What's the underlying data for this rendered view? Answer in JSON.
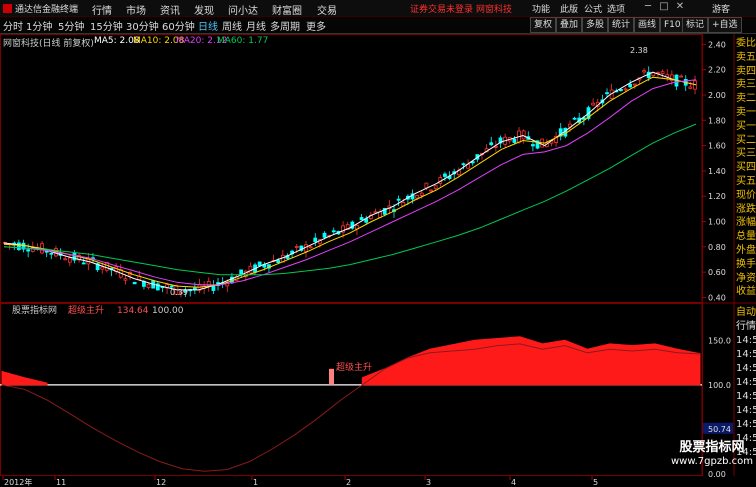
{
  "app": {
    "title": "通达信金融终端",
    "menu": [
      "行情",
      "市场",
      "资讯",
      "发现",
      "问小达",
      "财富圈",
      "交易"
    ],
    "notice": "证券交易未登录",
    "notice2": "网窗科技",
    "right_menu": [
      "功能",
      "此版",
      "公式",
      "选项"
    ],
    "guest": "游客"
  },
  "periods": [
    "分时",
    "1分钟",
    "5分钟",
    "15分钟",
    "30分钟",
    "60分钟",
    "日线",
    "周线",
    "月线",
    "多周期",
    "更多"
  ],
  "active_period": "日线",
  "toolbar": [
    "复权",
    "叠加",
    "多股",
    "统计",
    "画线",
    "F10",
    "标记",
    "+自选"
  ],
  "stock": {
    "name": "网窗科技(日线 前复权)",
    "ma5": "MA5: 2.08",
    "ma10": "MA10: 2.08",
    "ma20": "MA20: 2.12",
    "ma60": "MA60: 1.77",
    "high_label": "2.38",
    "low_label": "0.39"
  },
  "colors": {
    "ma5": "#ffffff",
    "ma10": "#ffd700",
    "ma20": "#e040fb",
    "ma60": "#00c853",
    "up": "#ff3232",
    "down": "#00ffff"
  },
  "price_axis": [
    "2.40",
    "2.20",
    "2.00",
    "1.80",
    "1.60",
    "1.40",
    "1.20",
    "1.00",
    "0.80",
    "0.60",
    "0.40"
  ],
  "right_panel_top": [
    "委比",
    "卖五",
    "卖四",
    "卖三",
    "卖二",
    "卖一",
    "买一",
    "买二",
    "买三",
    "买四",
    "买五",
    "现价",
    "涨跌",
    "涨幅",
    "总量",
    "外盘",
    "换手",
    "净资",
    "收益"
  ],
  "indicator": {
    "name": "股票指标网",
    "series_name": "超级主升",
    "value": "134.64",
    "value2": "100.00",
    "signal_label": "超级主升",
    "axis": [
      "150.0",
      "100.0",
      "50.74",
      "0.00"
    ]
  },
  "right_panel_bottom": [
    "自动",
    "行情",
    "14:56",
    "14:56",
    "14:56",
    "14:56",
    "14:56",
    "14:56",
    "14:56",
    "14:56",
    "14:56"
  ],
  "x_axis": [
    "2012年",
    "11",
    "12",
    "1",
    "2",
    "3",
    "4",
    "5"
  ],
  "watermark": {
    "cn": "股票指标网",
    "url": "www.7gpzb.com"
  },
  "chart_data": {
    "type": "line",
    "title": "网窗科技(日线 前复权)",
    "ylim": [
      0.38,
      2.45
    ],
    "series": [
      {
        "name": "MA5",
        "values": [
          0.83,
          0.81,
          0.77,
          0.72,
          0.68,
          0.62,
          0.55,
          0.5,
          0.46,
          0.46,
          0.51,
          0.58,
          0.66,
          0.72,
          0.8,
          0.88,
          0.95,
          1.05,
          1.12,
          1.22,
          1.3,
          1.4,
          1.52,
          1.63,
          1.68,
          1.6,
          1.72,
          1.85,
          2.0,
          2.1,
          2.18,
          2.12,
          2.08
        ]
      },
      {
        "name": "MA10",
        "values": [
          0.82,
          0.81,
          0.78,
          0.74,
          0.7,
          0.64,
          0.58,
          0.53,
          0.49,
          0.48,
          0.5,
          0.56,
          0.62,
          0.69,
          0.76,
          0.84,
          0.91,
          1.0,
          1.08,
          1.17,
          1.25,
          1.35,
          1.46,
          1.57,
          1.64,
          1.62,
          1.7,
          1.82,
          1.95,
          2.05,
          2.14,
          2.12,
          2.08
        ]
      },
      {
        "name": "MA20",
        "values": [
          0.8,
          0.79,
          0.77,
          0.74,
          0.71,
          0.66,
          0.61,
          0.56,
          0.52,
          0.5,
          0.5,
          0.53,
          0.58,
          0.64,
          0.7,
          0.77,
          0.84,
          0.92,
          1.0,
          1.08,
          1.16,
          1.25,
          1.35,
          1.45,
          1.53,
          1.55,
          1.6,
          1.7,
          1.82,
          1.95,
          2.05,
          2.1,
          2.12
        ]
      },
      {
        "name": "MA60",
        "values": [
          0.8,
          0.79,
          0.78,
          0.76,
          0.74,
          0.71,
          0.68,
          0.65,
          0.62,
          0.6,
          0.58,
          0.58,
          0.58,
          0.59,
          0.61,
          0.63,
          0.66,
          0.7,
          0.74,
          0.79,
          0.84,
          0.89,
          0.95,
          1.02,
          1.09,
          1.16,
          1.24,
          1.33,
          1.42,
          1.52,
          1.62,
          1.7,
          1.77
        ]
      }
    ],
    "indicator_series": {
      "name": "超级主升",
      "ylim": [
        0,
        175
      ],
      "line_values": [
        100,
        95,
        83,
        68,
        52,
        38,
        25,
        14,
        6,
        3,
        5,
        14,
        28,
        44,
        62,
        82,
        100,
        118,
        130,
        136,
        138,
        140,
        144,
        146,
        140,
        144,
        136,
        140,
        138,
        140,
        136,
        134.64
      ],
      "area_values": [
        115,
        108,
        102,
        0,
        0,
        0,
        0,
        0,
        0,
        0,
        0,
        0,
        0,
        0,
        0,
        0,
        108,
        118,
        130,
        140,
        145,
        150,
        152,
        154,
        146,
        150,
        140,
        146,
        144,
        146,
        140,
        135
      ],
      "baseline": 100
    },
    "ticks_x": [
      "2012年",
      "11",
      "12",
      "1",
      "2",
      "3",
      "4",
      "5"
    ],
    "ticks_y": [
      "2.40",
      "2.20",
      "2.00",
      "1.80",
      "1.60",
      "1.40",
      "1.20",
      "1.00",
      "0.80",
      "0.60",
      "0.40"
    ]
  }
}
